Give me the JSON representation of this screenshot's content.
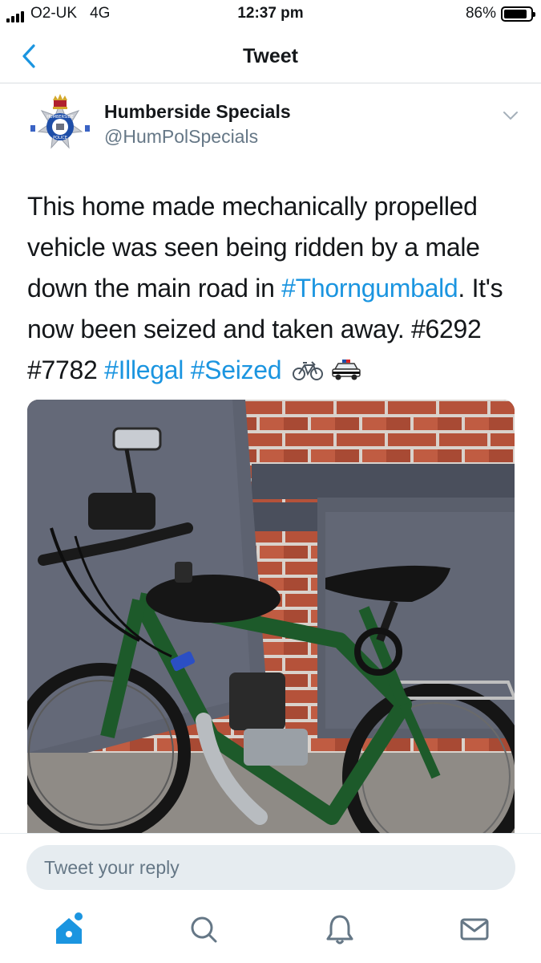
{
  "status_bar": {
    "carrier": "O2-UK",
    "network": "4G",
    "time": "12:37 pm",
    "battery_percent": "86%",
    "battery_level": 0.86
  },
  "nav": {
    "title": "Tweet",
    "back_icon": "chevron-left-icon"
  },
  "tweet": {
    "author_name": "Humberside Specials",
    "author_handle": "@HumPolSpecials",
    "avatar_icon": "police-crest-icon",
    "text_part1": "This home made mechanically propelled vehicle was seen being ridden by a male down the main road in ",
    "hashtag_place": "#Thorngumbald",
    "text_part2": ". It's now been seized and taken away. #6292 #7782 ",
    "hashtag_illegal": "#Illegal",
    "hashtag_seized": "#Seized",
    "emoji_icons": [
      "bicycle-icon",
      "police-car-icon"
    ],
    "photo_icon": "motorised-bicycle-photo"
  },
  "reply": {
    "placeholder": "Tweet your reply"
  },
  "tabs": [
    {
      "name": "home-tab",
      "icon": "home-icon"
    },
    {
      "name": "search-tab",
      "icon": "search-icon"
    },
    {
      "name": "notifications-tab",
      "icon": "bell-icon"
    },
    {
      "name": "messages-tab",
      "icon": "mail-icon"
    }
  ],
  "colors": {
    "accent": "#1b95e0",
    "handle": "#657786",
    "reply_bg": "#e6ecf0"
  }
}
